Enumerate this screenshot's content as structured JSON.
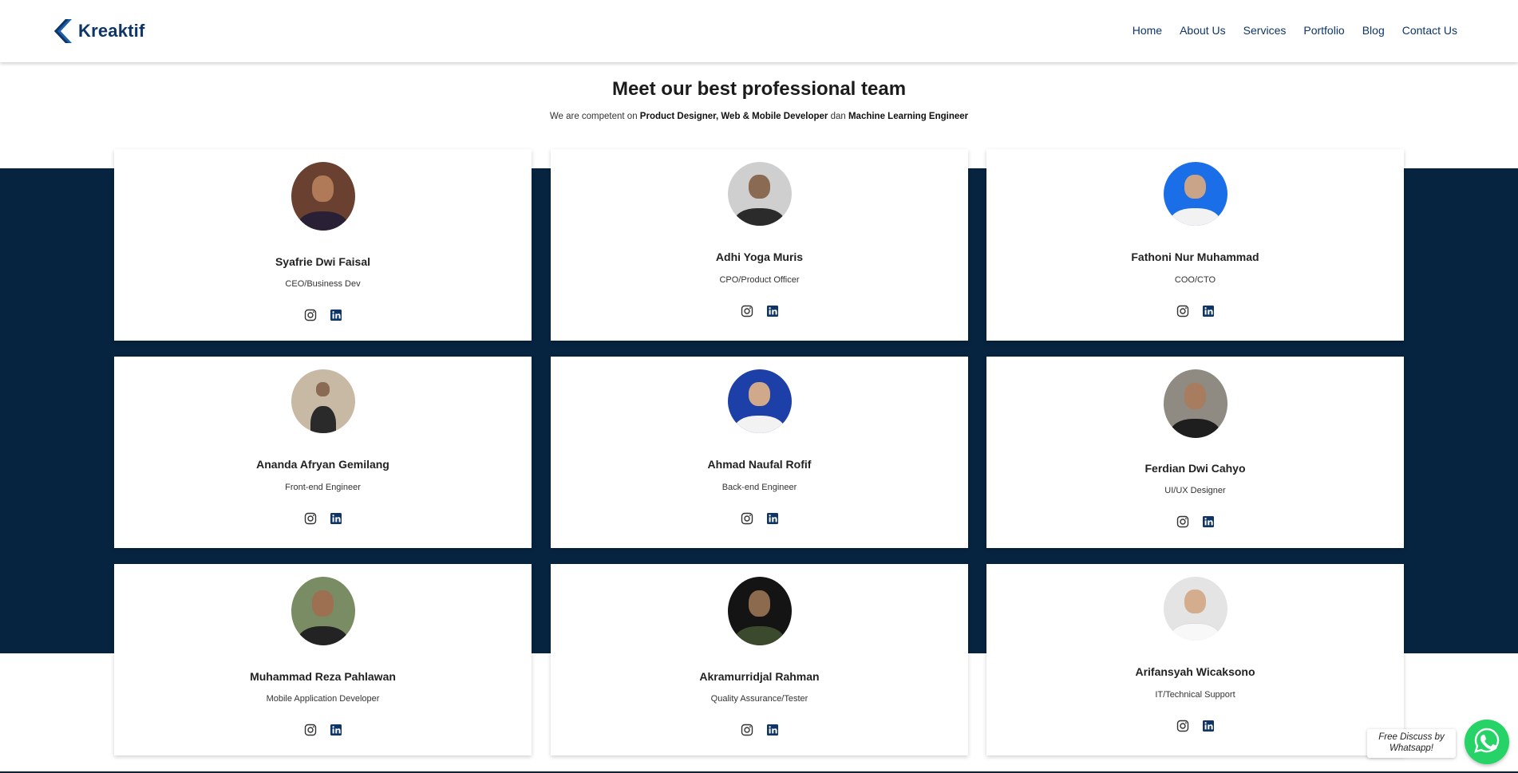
{
  "brand": {
    "name": "Kreaktif"
  },
  "nav": [
    {
      "label": "Home"
    },
    {
      "label": "About Us"
    },
    {
      "label": "Services"
    },
    {
      "label": "Portfolio"
    },
    {
      "label": "Blog"
    },
    {
      "label": "Contact Us"
    }
  ],
  "section": {
    "title": "Meet our best professional team",
    "subtitle": {
      "prefix": "We are competent on ",
      "skill_a": "Product Designer, Web & Mobile Developer",
      "connector": " dan ",
      "skill_b": "Machine Learning Engineer"
    }
  },
  "team": [
    {
      "name": "Syafrie Dwi Faisal",
      "role": "CEO/Business Dev"
    },
    {
      "name": "Adhi Yoga Muris",
      "role": "CPO/Product Officer"
    },
    {
      "name": "Fathoni Nur Muhammad",
      "role": "COO/CTO"
    },
    {
      "name": "Ananda Afryan Gemilang",
      "role": "Front-end Engineer"
    },
    {
      "name": "Ahmad Naufal Rofif",
      "role": "Back-end Engineer"
    },
    {
      "name": "Ferdian Dwi Cahyo",
      "role": "UI/UX Designer"
    },
    {
      "name": "Muhammad Reza Pahlawan",
      "role": "Mobile Application Developer"
    },
    {
      "name": "Akramurridjal Rahman",
      "role": "Quality Assurance/Tester"
    },
    {
      "name": "Arifansyah Wicaksono",
      "role": "IT/Technical Support"
    }
  ],
  "whatsapp": {
    "line1": "Free Discuss by",
    "line2": "Whatsapp!"
  },
  "colors": {
    "navy": "#062340",
    "brand": "#0e3566",
    "whatsapp": "#25d366"
  },
  "icons": [
    "kreaktif-logo-icon",
    "instagram-icon",
    "linkedin-icon",
    "whatsapp-icon"
  ]
}
